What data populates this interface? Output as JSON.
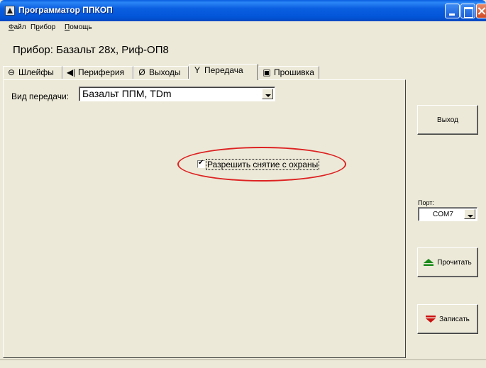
{
  "window": {
    "title": "Программатор ППКОП",
    "icon": "app-triangle-icon",
    "colors": {
      "titlebar": "#0a5ee0",
      "close": "#cf4a24",
      "face": "#ece9d8"
    }
  },
  "menu": [
    {
      "label": "Файл",
      "accel": "Ф"
    },
    {
      "label": "Прибор",
      "accel": "р"
    },
    {
      "label": "Помощь",
      "accel": "П"
    }
  ],
  "device": {
    "title": "Прибор: Базальт 28х, Риф-ОП8"
  },
  "tabs": [
    {
      "label": "Шлейфы",
      "icon": "theta-icon",
      "glyph": "⊖"
    },
    {
      "label": "Периферия",
      "icon": "speaker-icon",
      "glyph": "◀|"
    },
    {
      "label": "Выходы",
      "icon": "outputs-icon",
      "glyph": "Ø"
    },
    {
      "label": "Передача",
      "icon": "antenna-icon",
      "glyph": "Y"
    },
    {
      "label": "Прошивка",
      "icon": "chip-icon",
      "glyph": "▣"
    }
  ],
  "active_tab": "Передача",
  "transfer": {
    "type_label": "Вид передачи:",
    "type_value": "Базальт ППМ, TDm",
    "allow_disarm_label": "Разрешить снятие с охраны",
    "allow_disarm_checked": true,
    "highlight_color": "#dd2222"
  },
  "sidebar": {
    "exit_label": "Выход",
    "port_label": "Порт:",
    "port_value": "COM7",
    "read_label": "Прочитать",
    "read_icon": "eject-up-icon",
    "write_label": "Записать",
    "write_icon": "eject-down-icon",
    "icon_colors": {
      "read": "#1a8a1a",
      "write": "#cc1010"
    }
  }
}
